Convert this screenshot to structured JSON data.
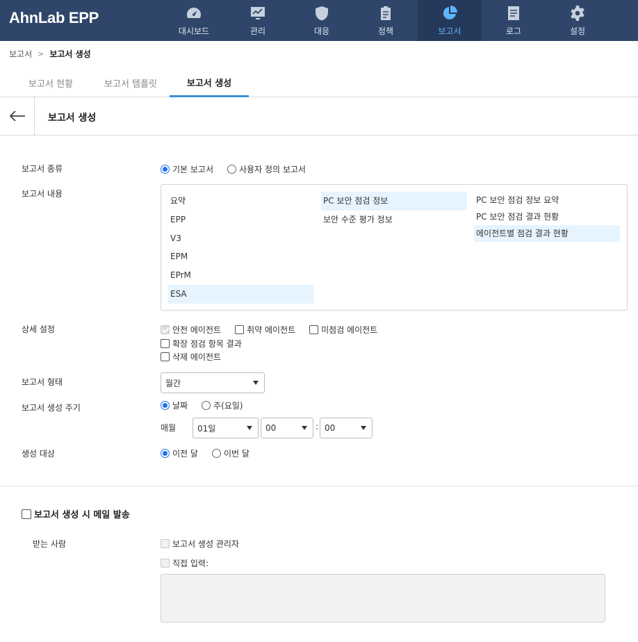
{
  "app": {
    "logo": "AhnLab EPP"
  },
  "nav": {
    "items": [
      {
        "label": "대시보드",
        "icon": "dashboard-icon"
      },
      {
        "label": "관리",
        "icon": "monitor-icon"
      },
      {
        "label": "대응",
        "icon": "shield-icon"
      },
      {
        "label": "정책",
        "icon": "clipboard-icon"
      },
      {
        "label": "보고서",
        "icon": "pie-chart-icon",
        "active": true
      },
      {
        "label": "로그",
        "icon": "document-icon"
      },
      {
        "label": "설정",
        "icon": "gear-icon"
      }
    ]
  },
  "breadcrumb": {
    "parent": "보고서",
    "current": "보고서 생성"
  },
  "tabs": [
    {
      "label": "보고서 현황"
    },
    {
      "label": "보고서 템플릿"
    },
    {
      "label": "보고서 생성",
      "active": true
    }
  ],
  "page": {
    "title": "보고서 생성"
  },
  "form": {
    "report_type": {
      "label": "보고서 종류",
      "options": [
        "기본 보고서",
        "사용자 정의 보고서"
      ],
      "selected": "기본 보고서"
    },
    "report_content": {
      "label": "보고서 내용",
      "col1": [
        "요약",
        "EPP",
        "V3",
        "EPM",
        "EPrM",
        "ESA"
      ],
      "col2": [
        "PC 보안 점검 정보",
        "보안 수준 평가 정보"
      ],
      "col3": [
        "PC 보안 점검 정보 요약",
        "PC 보안 점검 결과 현황",
        "에이전트별 점검 결과 현황"
      ]
    },
    "detail": {
      "label": "상세 설정",
      "options": [
        "안전 에이전트",
        "취약 에이전트",
        "미점검 에이전트",
        "확장 점검 항목 결과",
        "삭제 에이전트"
      ]
    },
    "report_format": {
      "label": "보고서 형태",
      "value": "월간"
    },
    "cycle": {
      "label": "보고서 생성 주기",
      "options": [
        "날짜",
        "주(요일)"
      ],
      "selected": "날짜",
      "every_label": "매월",
      "day": "01일",
      "hour": "00",
      "colon": ":",
      "minute": "00"
    },
    "target": {
      "label": "생성 대상",
      "options": [
        "이전 달",
        "이번 달"
      ],
      "selected": "이전 달"
    }
  },
  "mail": {
    "toggle_label": "보고서 생성 시 메일 발송",
    "recipients_label": "받는 사람",
    "options": [
      "보고서 생성 관리자",
      "직접 입력:"
    ]
  }
}
